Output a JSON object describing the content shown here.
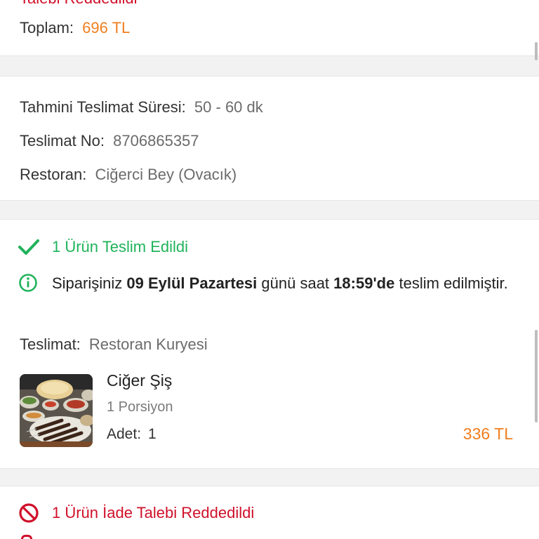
{
  "summary": {
    "clipped_status_text": "Talebi Reddedildi",
    "total_label": "Toplam:",
    "total_value": "696 TL"
  },
  "delivery_info": {
    "eta_label": "Tahmini Teslimat Süresi:",
    "eta_value": "50 - 60 dk",
    "delivery_no_label": "Teslimat No:",
    "delivery_no_value": "8706865357",
    "restaurant_label": "Restoran:",
    "restaurant_value": "Ciğerci Bey (Ovacık)"
  },
  "delivered_section": {
    "status_icon": "check-icon",
    "status_text": "1 Ürün Teslim Edildi",
    "status_color": "#1fb35a",
    "info_icon": "info-icon",
    "info_prefix": "Siparişiniz",
    "info_date": "09 Eylül Pazartesi",
    "info_mid": "günü saat",
    "info_time": "18:59'de",
    "info_suffix": "teslim edilmiştir.",
    "delivery_label": "Teslimat:",
    "delivery_value": "Restoran Kuryesi",
    "product": {
      "name": "Ciğer Şiş",
      "portion": "1 Porsiyon",
      "qty_label": "Adet:",
      "qty_value": "1",
      "price": "336 TL"
    }
  },
  "rejected_section": {
    "status_icon": "prohibited-icon",
    "status_text": "1 Ürün İade Talebi Reddedildi",
    "status_color": "#d0102a"
  },
  "colors": {
    "accent_orange": "#f07f1f",
    "success_green": "#1fb35a",
    "error_red": "#d0102a"
  }
}
